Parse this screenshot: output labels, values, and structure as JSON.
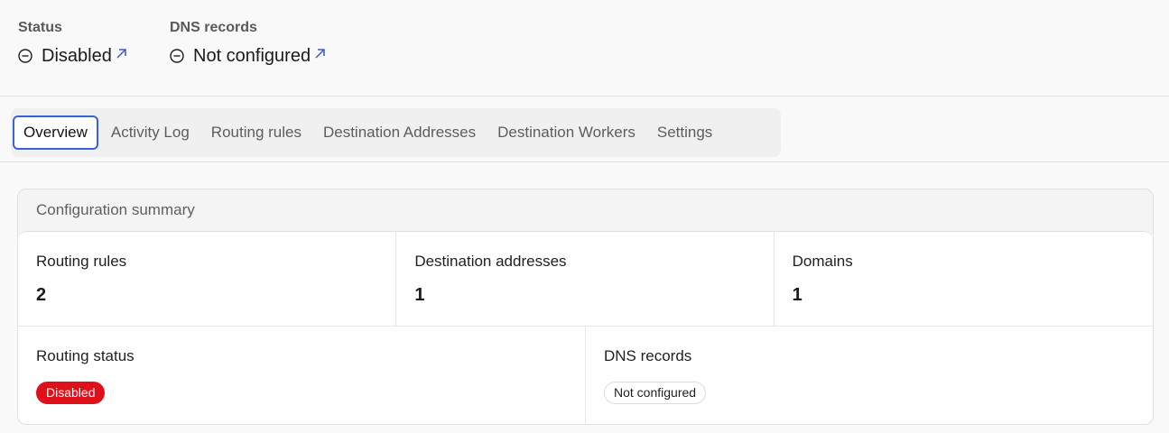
{
  "header": {
    "status": {
      "label": "Status",
      "value": "Disabled",
      "icon": "minus-circle-icon",
      "link_icon": "external-link-icon"
    },
    "dns": {
      "label": "DNS records",
      "value": "Not configured",
      "icon": "minus-circle-icon",
      "link_icon": "external-link-icon"
    }
  },
  "tabs": [
    {
      "label": "Overview",
      "active": true
    },
    {
      "label": "Activity Log"
    },
    {
      "label": "Routing rules"
    },
    {
      "label": "Destination Addresses"
    },
    {
      "label": "Destination Workers"
    },
    {
      "label": "Settings"
    }
  ],
  "summary": {
    "title": "Configuration summary",
    "routing_rules": {
      "label": "Routing rules",
      "value": "2"
    },
    "destination_addresses": {
      "label": "Destination addresses",
      "value": "1"
    },
    "domains": {
      "label": "Domains",
      "value": "1"
    },
    "routing_status": {
      "label": "Routing status",
      "badge": "Disabled"
    },
    "dns_records": {
      "label": "DNS records",
      "badge": "Not configured"
    }
  },
  "colors": {
    "accent": "#3563d8",
    "link": "#3a5bc7",
    "danger": "#e0101a"
  }
}
